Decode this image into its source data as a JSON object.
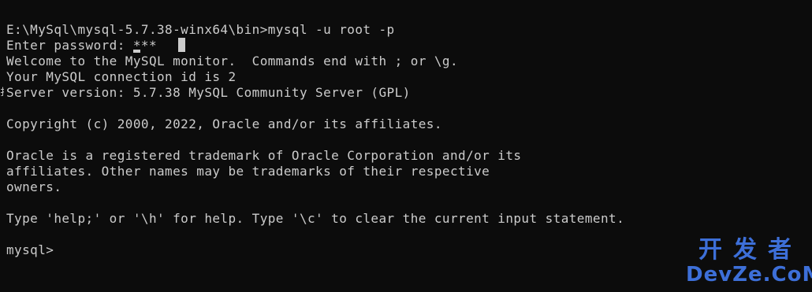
{
  "terminal": {
    "lines": [
      "E:\\MySql\\mysql-5.7.38-winx64\\bin>mysql -u root -p",
      "Enter password: ***",
      "Welcome to the MySQL monitor.  Commands end with ; or \\g.",
      "Your MySQL connection id is 2",
      "Server version: 5.7.38 MySQL Community Server (GPL)",
      "",
      "Copyright (c) 2000, 2022, Oracle and/or its affiliates.",
      "",
      "Oracle is a registered trademark of Oracle Corporation and/or its",
      "affiliates. Other names may be trademarks of their respective",
      "owners.",
      "",
      "Type 'help;' or '\\h' for help. Type '\\c' to clear the current input statement.",
      "",
      "mysql>"
    ],
    "password_prefix": "Enter password: ",
    "password_mask_first": "*",
    "password_mask_rest": "**",
    "prompt": "mysql>"
  },
  "colors": {
    "background": "#0c0c0c",
    "text": "#cccccc",
    "watermark": "#3d6fd8"
  },
  "watermark": {
    "top": "开发者",
    "bottom": "DevZe.CoM"
  }
}
